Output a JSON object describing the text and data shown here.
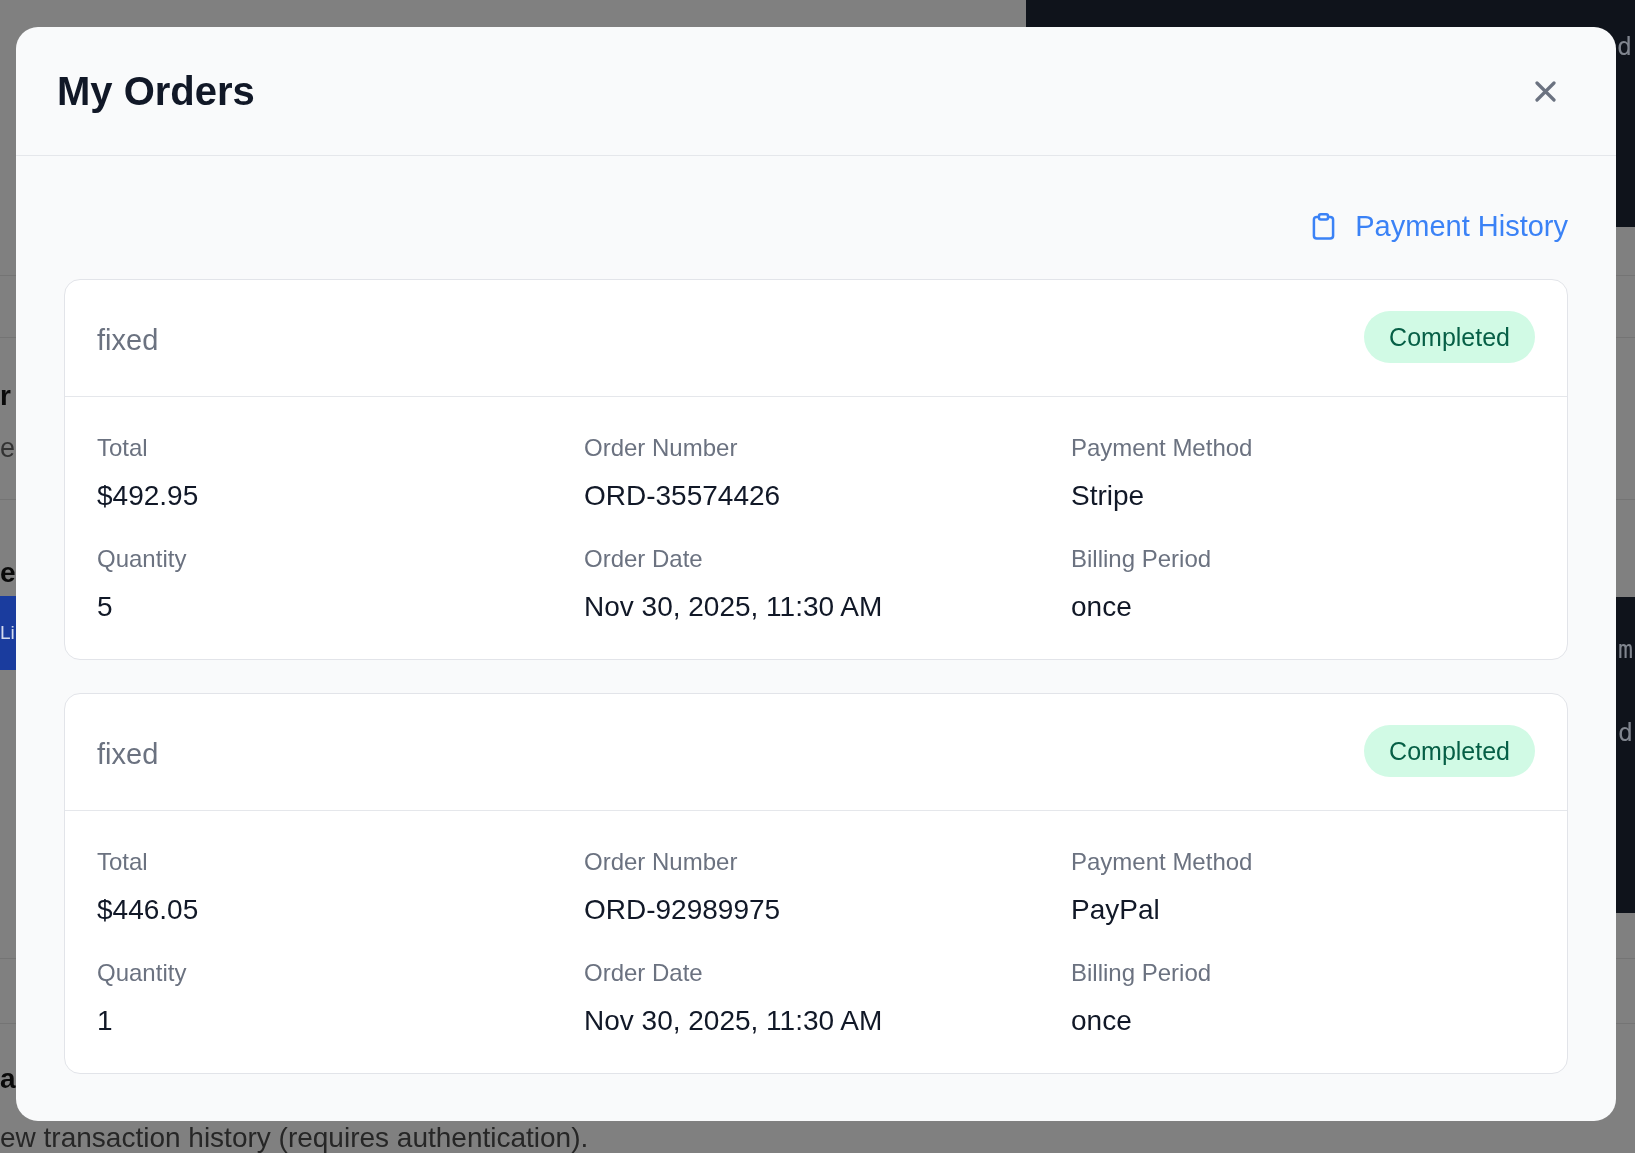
{
  "background": {
    "top_panel_text": "d",
    "section_1": {
      "heading": "r",
      "subtitle": "e"
    },
    "section_2": {
      "heading": "e",
      "button": "Li"
    },
    "side_panel_texts": [
      "m",
      "d"
    ],
    "section_3": {
      "heading": "a",
      "text": "ew transaction history (requires authentication)."
    }
  },
  "dialog": {
    "title": "My Orders",
    "link": "Payment History",
    "orders": [
      {
        "title": "fixed",
        "status": {
          "label": "Completed",
          "kind": "completed"
        },
        "fields": [
          {
            "label": "Total",
            "value": "$492.95"
          },
          {
            "label": "Order Number",
            "value": "ORD-35574426"
          },
          {
            "label": "Payment Method",
            "value": "Stripe"
          },
          {
            "label": "Quantity",
            "value": "5"
          },
          {
            "label": "Order Date",
            "value": "Nov 30, 2025, 11:30 AM"
          },
          {
            "label": "Billing Period",
            "value": "once"
          }
        ]
      },
      {
        "title": "fixed",
        "status": {
          "label": "Completed",
          "kind": "completed"
        },
        "fields": [
          {
            "label": "Total",
            "value": "$446.05"
          },
          {
            "label": "Order Number",
            "value": "ORD-92989975"
          },
          {
            "label": "Payment Method",
            "value": "PayPal"
          },
          {
            "label": "Quantity",
            "value": "1"
          },
          {
            "label": "Order Date",
            "value": "Nov 30, 2025, 11:30 AM"
          },
          {
            "label": "Billing Period",
            "value": "once"
          }
        ]
      }
    ]
  }
}
